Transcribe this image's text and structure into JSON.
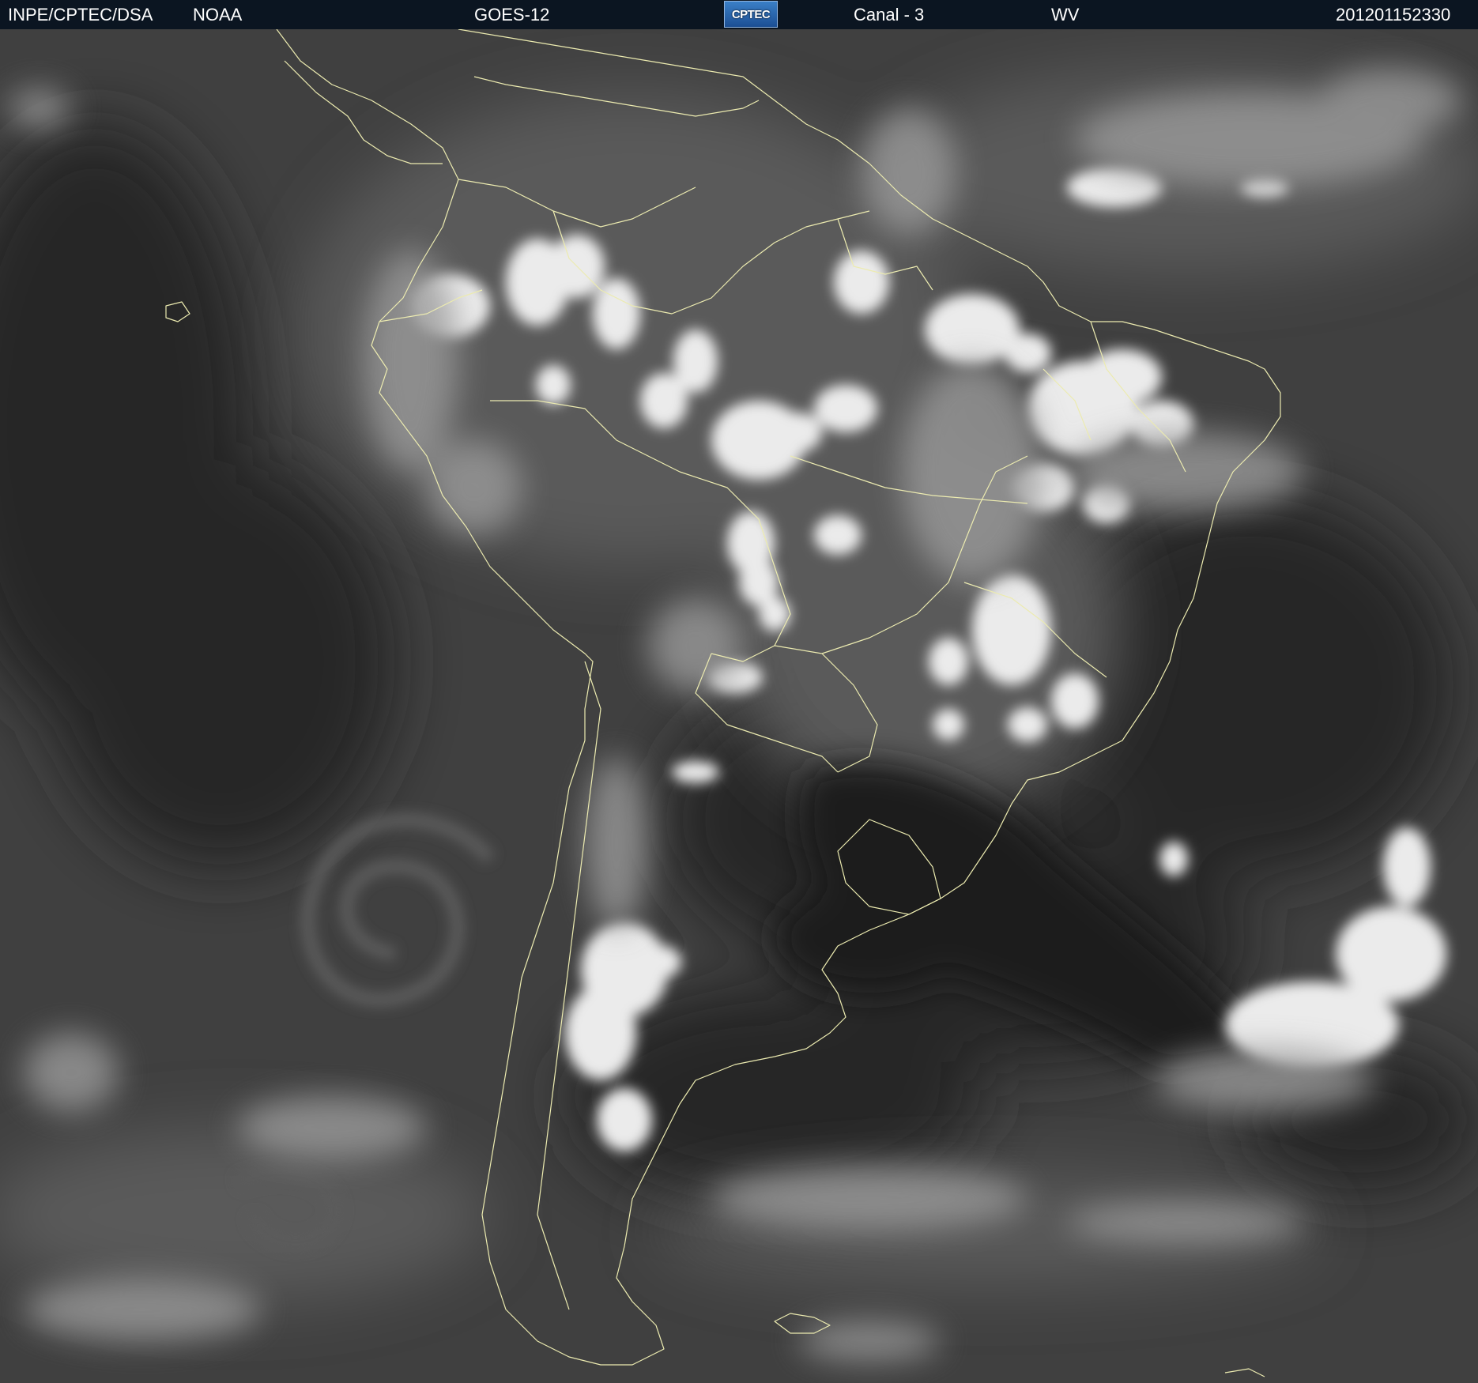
{
  "header": {
    "agency": "INPE/CPTEC/DSA",
    "source": "NOAA",
    "satellite": "GOES-12",
    "logo_text": "CPTEC",
    "channel": "Canal - 3",
    "band": "WV",
    "timestamp": "201201152330"
  },
  "map": {
    "region": "South America",
    "type": "water-vapor satellite image",
    "colors": {
      "background": "#3f3f3f",
      "dark_dry": "#222222",
      "cloud": "#f0f0f0",
      "borders": "#ecebb0",
      "header": "#0b1521"
    }
  }
}
